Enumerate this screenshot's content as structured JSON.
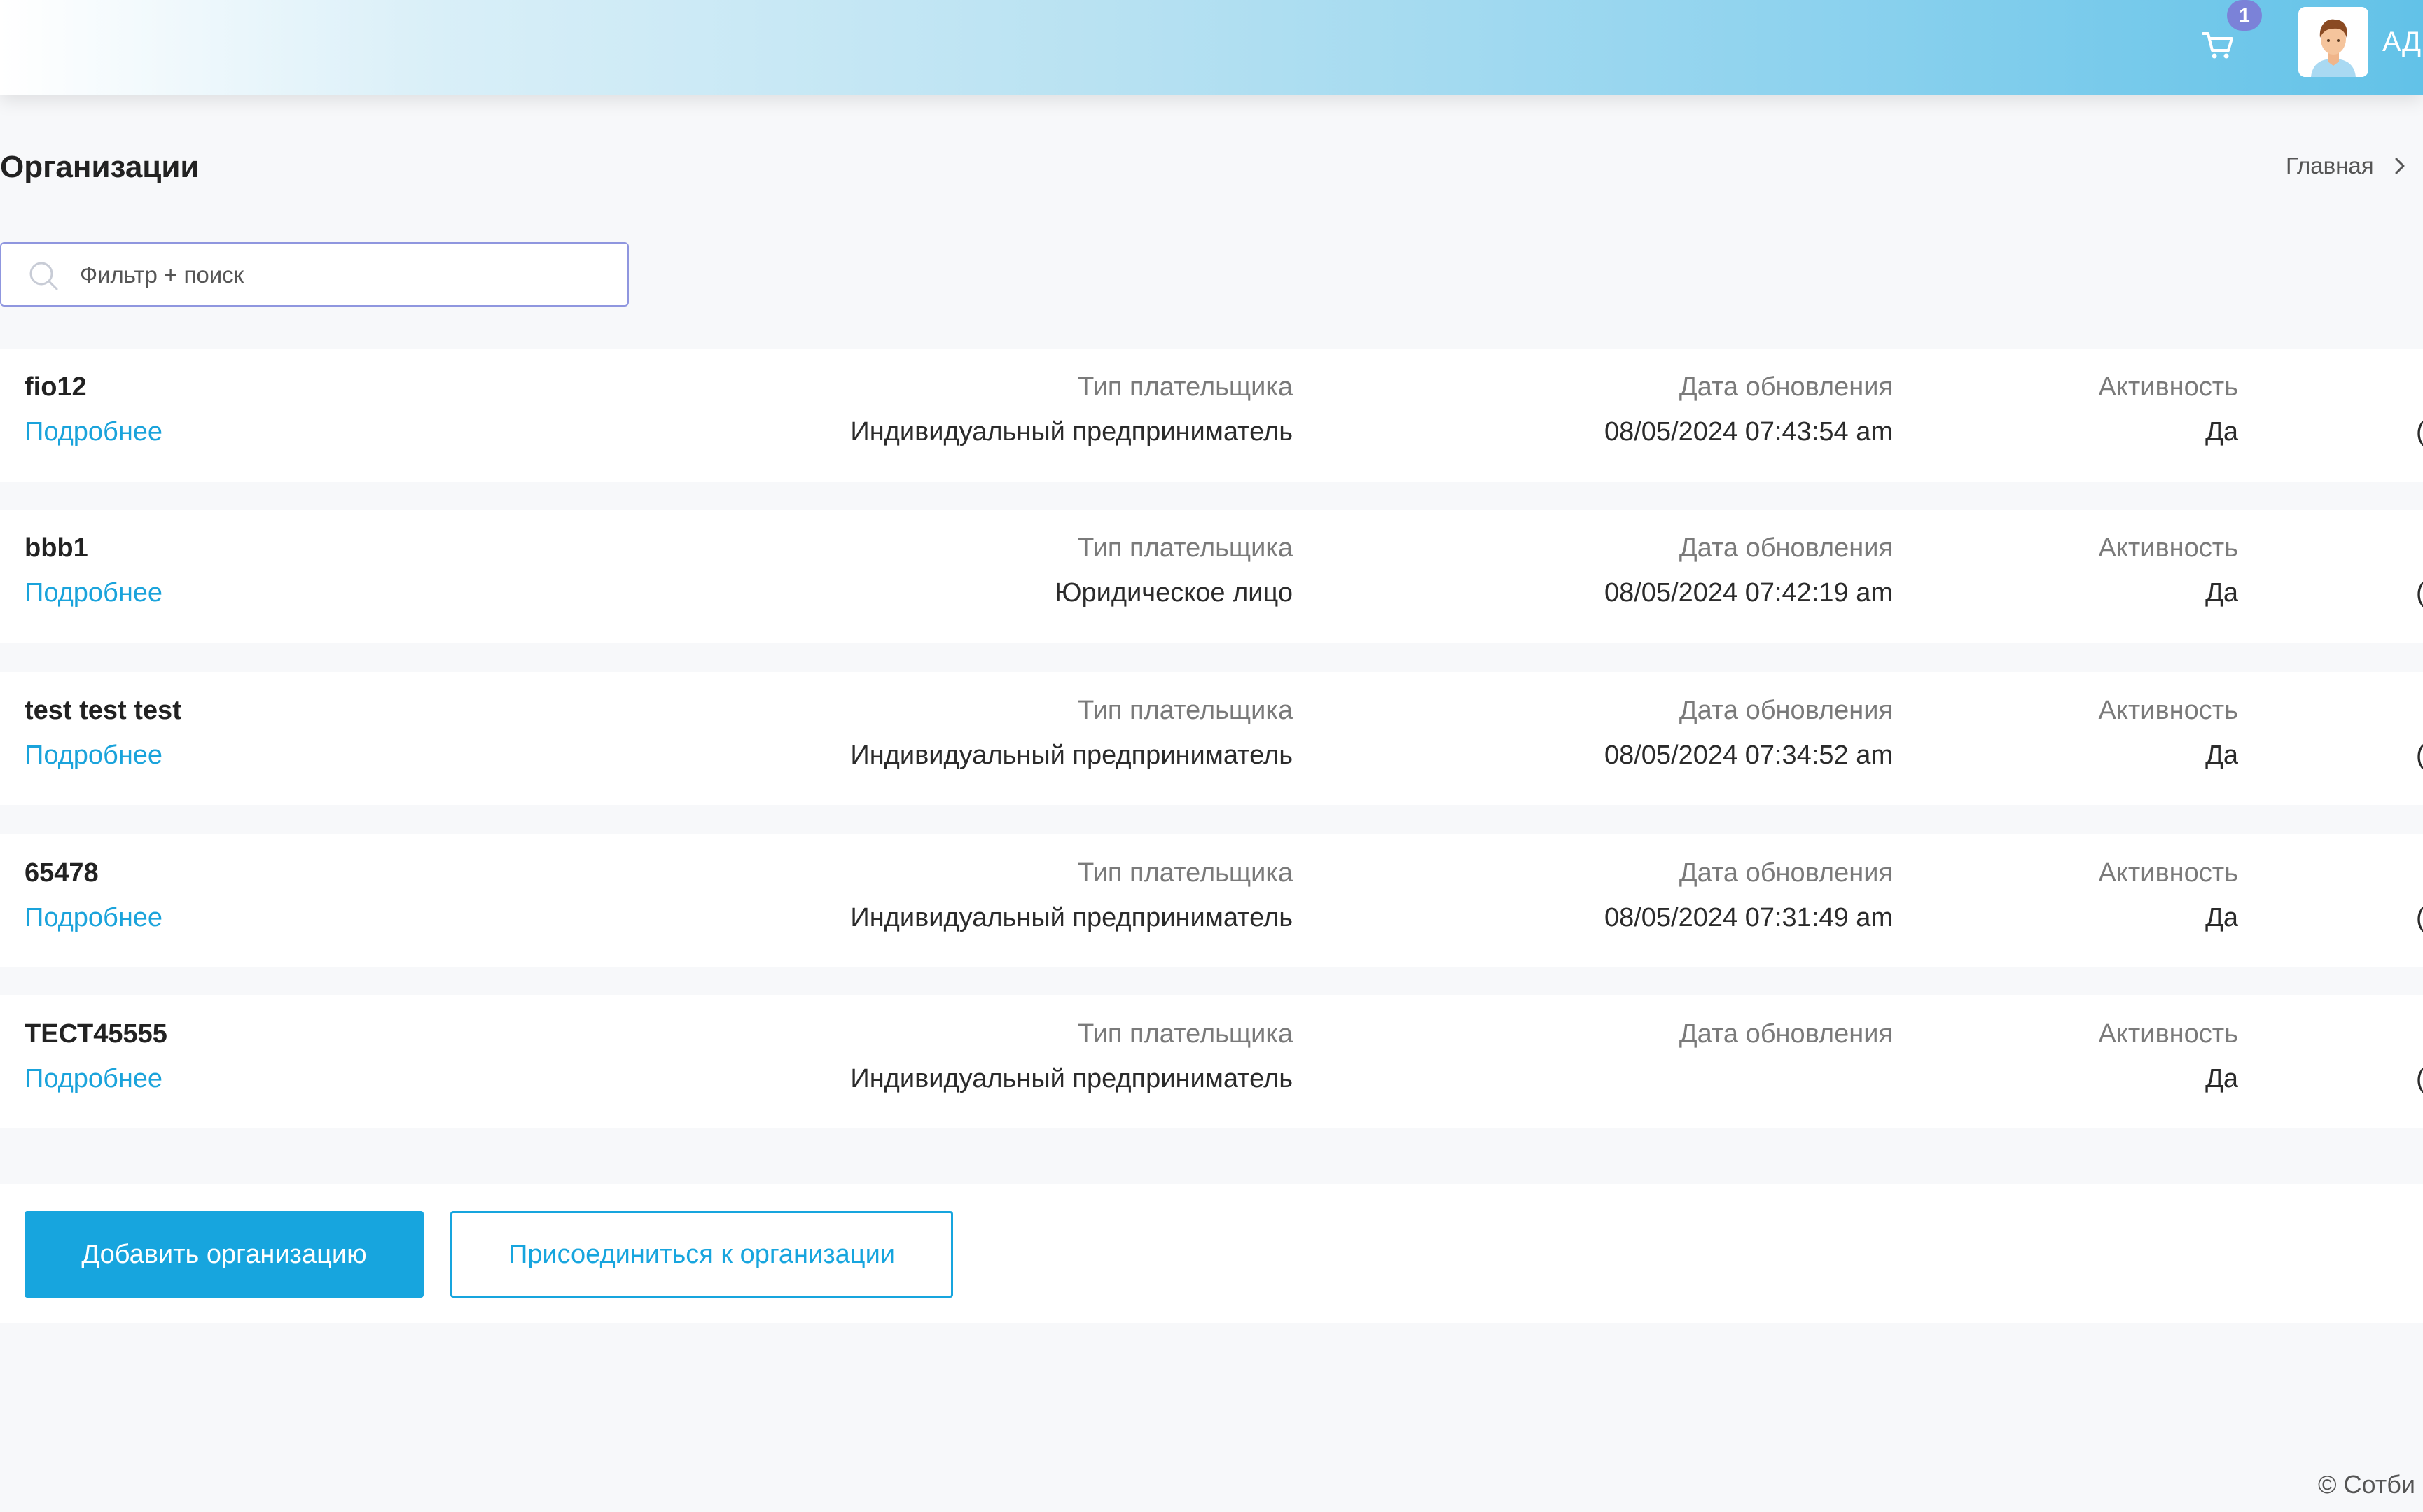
{
  "header": {
    "cart_count": "1",
    "user_name": "АД"
  },
  "page": {
    "title": "Организации",
    "breadcrumb_home": "Главная"
  },
  "search": {
    "placeholder": "Фильтр + поиск",
    "value": ""
  },
  "columns": {
    "payer_type": "Тип плательщика",
    "updated": "Дата обновления",
    "activity": "Активность"
  },
  "organizations": [
    {
      "name": "fio12",
      "link": "Подробнее",
      "payer_type": "Индивидуальный предприниматель",
      "updated": "08/05/2024 07:43:54 am",
      "activity": "Да",
      "edge": "("
    },
    {
      "name": "bbb1",
      "link": "Подробнее",
      "payer_type": "Юридическое лицо",
      "updated": "08/05/2024 07:42:19 am",
      "activity": "Да",
      "edge": "("
    },
    {
      "name": "test test test",
      "link": "Подробнее",
      "payer_type": "Индивидуальный предприниматель",
      "updated": "08/05/2024 07:34:52 am",
      "activity": "Да",
      "edge": "("
    },
    {
      "name": "65478",
      "link": "Подробнее",
      "payer_type": "Индивидуальный предприниматель",
      "updated": "08/05/2024 07:31:49 am",
      "activity": "Да",
      "edge": "("
    },
    {
      "name": "ТЕСТ45555",
      "link": "Подробнее",
      "payer_type": "Индивидуальный предприниматель",
      "updated": "",
      "activity": "Да",
      "edge": "("
    }
  ],
  "actions": {
    "add_label": "Добавить организацию",
    "join_label": "Присоединиться к организации"
  },
  "footer": {
    "copyright": "© Сотби"
  }
}
